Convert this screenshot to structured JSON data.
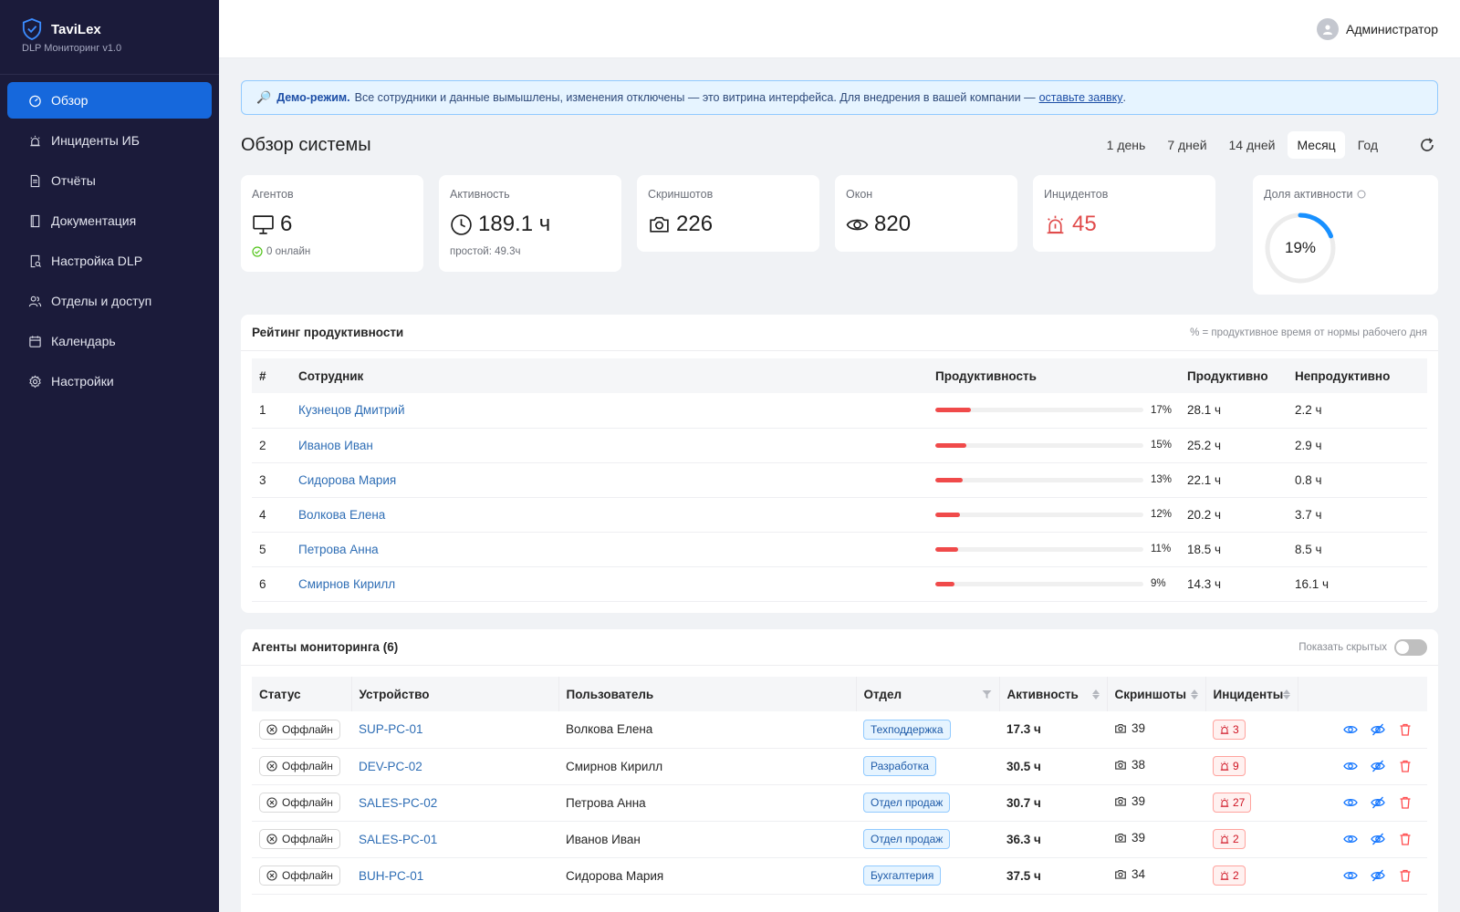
{
  "brand": {
    "name": "TaviLex",
    "subtitle": "DLP Мониторинг v1.0"
  },
  "sidebar": {
    "items": [
      {
        "label": "Обзор",
        "icon": "dashboard-icon",
        "active": true
      },
      {
        "label": "Инциденты ИБ",
        "icon": "alarm-icon"
      },
      {
        "label": "Отчёты",
        "icon": "file-icon"
      },
      {
        "label": "Документация",
        "icon": "book-icon"
      },
      {
        "label": "Настройка DLP",
        "icon": "file-search-icon"
      },
      {
        "label": "Отделы и доступ",
        "icon": "team-icon"
      },
      {
        "label": "Календарь",
        "icon": "calendar-icon"
      },
      {
        "label": "Настройки",
        "icon": "gear-icon"
      }
    ]
  },
  "header": {
    "user": "Администратор"
  },
  "demo": {
    "title": "Демо-режим.",
    "text": "Все сотрудники и данные вымышлены, изменения отключены — это витрина интерфейса. Для внедрения в вашей компании —",
    "link": "оставьте заявку",
    "tail": "."
  },
  "page": {
    "title": "Обзор системы"
  },
  "periods": [
    "1 день",
    "7 дней",
    "14 дней",
    "Месяц",
    "Год"
  ],
  "active_period": "Месяц",
  "stats": {
    "agents": {
      "label": "Агентов",
      "value": "6",
      "sub": "0 онлайн"
    },
    "activity": {
      "label": "Активность",
      "value": "189.1 ч",
      "sub": "простой: 49.3ч"
    },
    "screenshots": {
      "label": "Скриншотов",
      "value": "226"
    },
    "windows": {
      "label": "Окон",
      "value": "820"
    },
    "incidents": {
      "label": "Инцидентов",
      "value": "45"
    },
    "share": {
      "label": "Доля активности",
      "value": "19%",
      "fraction": 0.19
    }
  },
  "ranking": {
    "title": "Рейтинг продуктивности",
    "note": "% = продуктивное время от нормы рабочего дня",
    "columns": [
      "#",
      "Сотрудник",
      "Продуктивность",
      "Продуктивно",
      "Непродуктивно"
    ],
    "rows": [
      {
        "n": "1",
        "name": "Кузнецов Дмитрий",
        "pct": "17%",
        "fraction": 0.17,
        "prod": "28.1 ч",
        "unprod": "2.2 ч"
      },
      {
        "n": "2",
        "name": "Иванов Иван",
        "pct": "15%",
        "fraction": 0.15,
        "prod": "25.2 ч",
        "unprod": "2.9 ч"
      },
      {
        "n": "3",
        "name": "Сидорова Мария",
        "pct": "13%",
        "fraction": 0.13,
        "prod": "22.1 ч",
        "unprod": "0.8 ч"
      },
      {
        "n": "4",
        "name": "Волкова Елена",
        "pct": "12%",
        "fraction": 0.12,
        "prod": "20.2 ч",
        "unprod": "3.7 ч"
      },
      {
        "n": "5",
        "name": "Петрова Анна",
        "pct": "11%",
        "fraction": 0.11,
        "prod": "18.5 ч",
        "unprod": "8.5 ч"
      },
      {
        "n": "6",
        "name": "Смирнов Кирилл",
        "pct": "9%",
        "fraction": 0.09,
        "prod": "14.3 ч",
        "unprod": "16.1 ч"
      }
    ]
  },
  "agents": {
    "title": "Агенты мониторинга (6)",
    "show_hidden": "Показать скрытых",
    "columns": [
      "Статус",
      "Устройство",
      "Пользователь",
      "Отдел",
      "Активность",
      "Скриншоты",
      "Инциденты"
    ],
    "rows": [
      {
        "status": "Оффлайн",
        "device": "SUP-PC-01",
        "user": "Волкова Елена",
        "dept": "Техподдержка",
        "activity": "17.3 ч",
        "shots": "39",
        "incidents": "3"
      },
      {
        "status": "Оффлайн",
        "device": "DEV-PC-02",
        "user": "Смирнов Кирилл",
        "dept": "Разработка",
        "activity": "30.5 ч",
        "shots": "38",
        "incidents": "9"
      },
      {
        "status": "Оффлайн",
        "device": "SALES-PC-02",
        "user": "Петрова Анна",
        "dept": "Отдел продаж",
        "activity": "30.7 ч",
        "shots": "39",
        "incidents": "27"
      },
      {
        "status": "Оффлайн",
        "device": "SALES-PC-01",
        "user": "Иванов Иван",
        "dept": "Отдел продаж",
        "activity": "36.3 ч",
        "shots": "39",
        "incidents": "2"
      },
      {
        "status": "Оффлайн",
        "device": "BUH-PC-01",
        "user": "Сидорова Мария",
        "dept": "Бухгалтерия",
        "activity": "37.5 ч",
        "shots": "34",
        "incidents": "2"
      }
    ]
  },
  "colors": {
    "accent": "#1668dc",
    "sidebar": "#1b1b3a",
    "danger": "#e04a4a",
    "gauge": "#1890ff"
  }
}
